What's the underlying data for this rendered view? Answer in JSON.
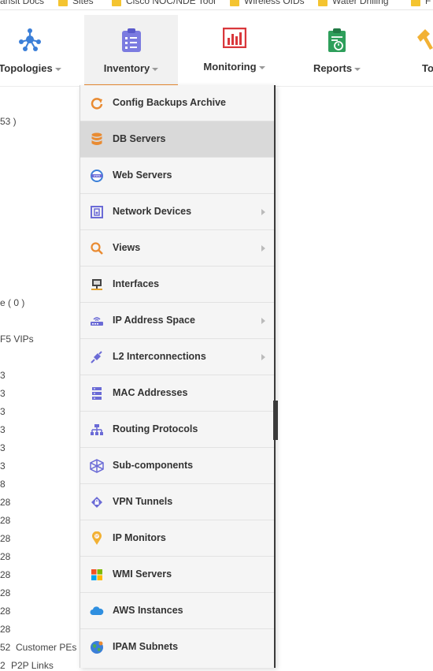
{
  "bookmarks": [
    {
      "label": "ansit Docs"
    },
    {
      "label": "Sites"
    },
    {
      "label": "Cisco NOC/NDE Tool"
    },
    {
      "label": "Wireless OIDs"
    },
    {
      "label": "Water  Drilling"
    },
    {
      "label": "F"
    }
  ],
  "nav": {
    "topologies": "Topologies",
    "inventory": "Inventory",
    "monitoring": "Monitoring",
    "reports": "Reports",
    "tools": "To"
  },
  "left_list": {
    "r1": "53 )",
    "r2": "e ( 0 )",
    "r3": "F5 VIPs",
    "nums": [
      "3",
      "3",
      "3",
      "3",
      "3",
      "3",
      "8",
      "28",
      "28",
      "28",
      "28",
      "28",
      "28",
      "28",
      "28"
    ],
    "customer_num": "52",
    "customer_label": "Customer PEs",
    "p2p_num": "2",
    "p2p_label": "P2P Links"
  },
  "menu": {
    "items": [
      {
        "label": "Config Backups Archive",
        "icon": "refresh-icon"
      },
      {
        "label": "DB Servers",
        "icon": "database-icon"
      },
      {
        "label": "Web Servers",
        "icon": "web-server-icon"
      },
      {
        "label": "Network Devices",
        "icon": "network-device-icon"
      },
      {
        "label": "Views",
        "icon": "search-icon"
      },
      {
        "label": "Interfaces",
        "icon": "interface-icon"
      },
      {
        "label": "IP Address Space",
        "icon": "router-icon"
      },
      {
        "label": "L2 Interconnections",
        "icon": "connector-icon"
      },
      {
        "label": "MAC Addresses",
        "icon": "server-stack-icon"
      },
      {
        "label": "Routing Protocols",
        "icon": "hierarchy-icon"
      },
      {
        "label": "Sub-components",
        "icon": "network-mesh-icon"
      },
      {
        "label": "VPN Tunnels",
        "icon": "vpn-lock-icon"
      },
      {
        "label": "IP Monitors",
        "icon": "map-pin-icon"
      },
      {
        "label": "WMI Servers",
        "icon": "windows-icon"
      },
      {
        "label": "AWS Instances",
        "icon": "cloud-icon"
      },
      {
        "label": "IPAM Subnets",
        "icon": "globe-icon"
      }
    ]
  },
  "colors": {
    "accent_orange": "#e98b32",
    "menu_bg": "#f5f5f5",
    "menu_highlight": "#d9d9d9",
    "icon_purple": "#6b6bd6",
    "icon_blue": "#3b7fd8",
    "reports_green": "#2e9f5b",
    "monitoring_red": "#d9373b"
  }
}
